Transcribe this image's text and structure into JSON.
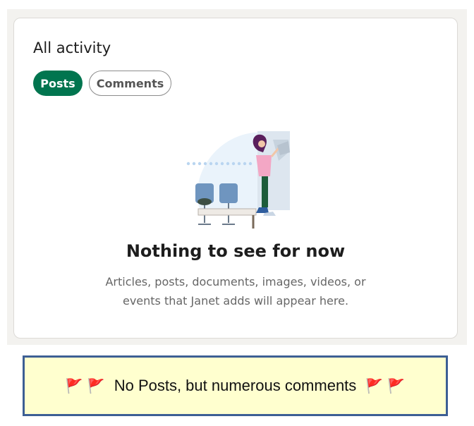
{
  "activity": {
    "title": "All activity",
    "tabs": [
      {
        "label": "Posts",
        "selected": true
      },
      {
        "label": "Comments",
        "selected": false
      }
    ],
    "empty_state": {
      "headline": "Nothing to see for now",
      "line1": "Articles, posts, documents, images, videos, or",
      "line2": "events that Janet adds will appear here."
    }
  },
  "banner": {
    "text": "No Posts, but numerous comments",
    "flag_icon": "triangular-flag-icon"
  },
  "colors": {
    "accent": "#01754f",
    "banner_bg": "#ffffcf",
    "banner_border": "#3d5f94"
  }
}
